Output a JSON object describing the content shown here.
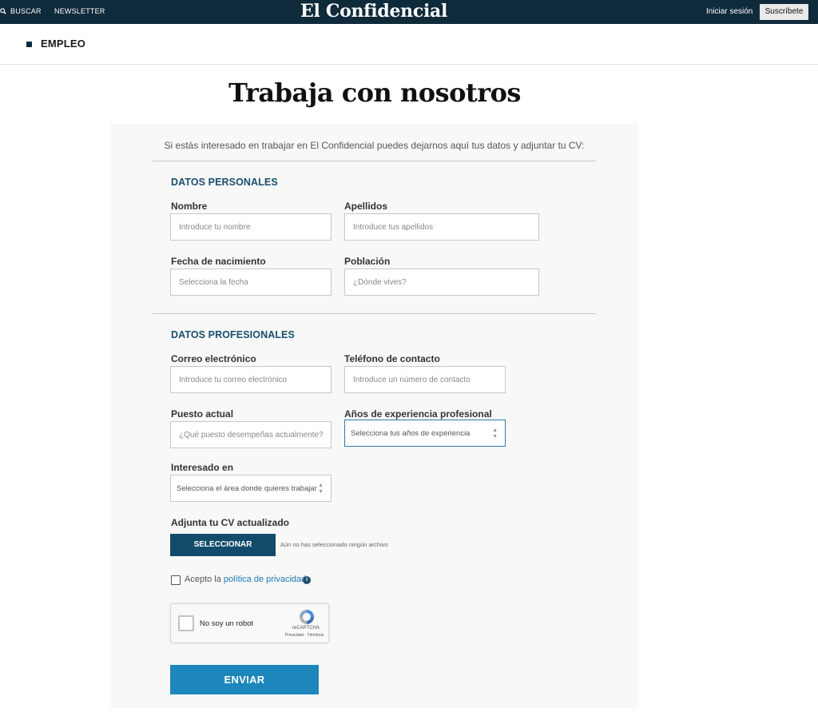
{
  "topbar": {
    "search_label": "BUSCAR",
    "newsletter_label": "NEWSLETTER",
    "logo_text": "El Confidencial",
    "login_label": "Iniciar sesión",
    "subscribe_label": "Suscríbete"
  },
  "section": {
    "label": "EMPLEO"
  },
  "page_title": "Trabaja con nosotros",
  "form": {
    "intro": "Si estás interesado en trabajar en El Confidencial puedes dejarnos aquí tus datos y adjuntar tu CV:",
    "personal_heading": "DATOS PERSONALES",
    "professional_heading": "DATOS PROFESIONALES",
    "fields": {
      "nombre": {
        "label": "Nombre",
        "placeholder": "Introduce tu nombre",
        "value": ""
      },
      "apellidos": {
        "label": "Apellidos",
        "placeholder": "Introduce tus apellidos",
        "value": ""
      },
      "fecha": {
        "label": "Fecha de nacimiento",
        "placeholder": "Selecciona la fecha",
        "value": ""
      },
      "poblacion": {
        "label": "Población",
        "placeholder": "¿Dónde vives?",
        "value": ""
      },
      "correo": {
        "label": "Correo electrónico",
        "placeholder": "Introduce tu correo electrónico",
        "value": ""
      },
      "telefono": {
        "label": "Teléfono de contacto",
        "placeholder": "Introduce un número de contacto",
        "value": ""
      },
      "puesto": {
        "label": "Puesto actual",
        "placeholder": "¿Qué puesto desempeñas actualmente?",
        "value": ""
      },
      "experiencia": {
        "label": "Años de experiencia profesional",
        "selected": "Selecciona tus años de experiencia"
      },
      "interesado": {
        "label": "Interesado en",
        "selected": "Selecciona el área donde quieres trabajar"
      }
    },
    "cv": {
      "label": "Adjunta tu CV actualizado",
      "button": "SELECCIONAR",
      "status": "Aún no has seleccionado ningún archivo"
    },
    "privacy": {
      "prefix": "Acepto la ",
      "link": "política de privacidad",
      "info_symbol": "i",
      "checked": false
    },
    "captcha": {
      "label": "No soy un robot",
      "brand": "reCAPTCHA",
      "terms": "Privacidad - Términos",
      "checked": false
    },
    "submit_label": "ENVIAR"
  },
  "colors": {
    "topbar_bg": "#0e2a3b",
    "heading_blue": "#1a4f6e",
    "select_button": "#134c6b",
    "submit_button": "#1d87bc",
    "link": "#1a78b5"
  }
}
